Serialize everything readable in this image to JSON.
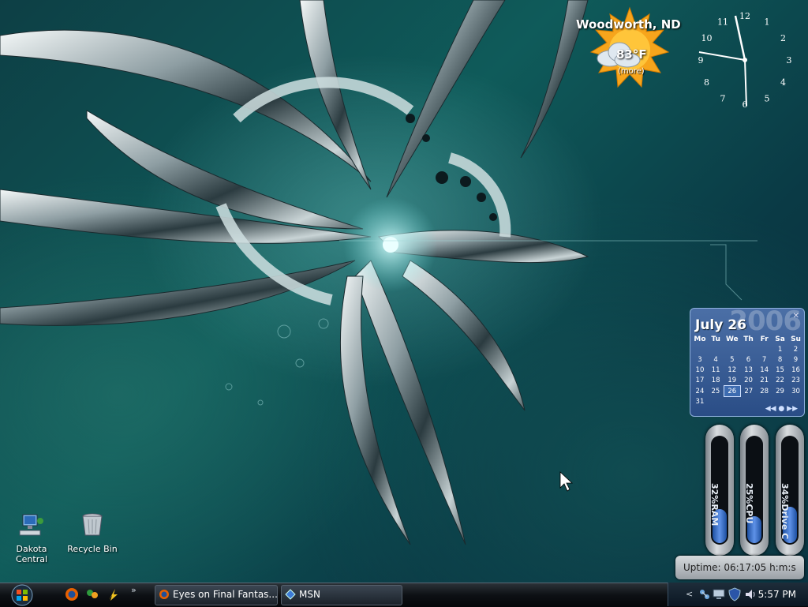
{
  "weather": {
    "city": "Woodworth,  ND",
    "temperature": "83°F",
    "more_link": "(more)"
  },
  "clock": {
    "numbers": [
      "12",
      "1",
      "2",
      "3",
      "4",
      "5",
      "6",
      "7",
      "8",
      "9",
      "10",
      "11"
    ]
  },
  "calendar": {
    "month_label": "July 26",
    "year_watermark": "2006",
    "weekdays": [
      "Mo",
      "Tu",
      "We",
      "Th",
      "Fr",
      "Sa",
      "Su"
    ],
    "weeks": [
      [
        "",
        "",
        "",
        "",
        "",
        "1",
        "2"
      ],
      [
        "3",
        "4",
        "5",
        "6",
        "7",
        "8",
        "9"
      ],
      [
        "10",
        "11",
        "12",
        "13",
        "14",
        "15",
        "16"
      ],
      [
        "17",
        "18",
        "19",
        "20",
        "21",
        "22",
        "23"
      ],
      [
        "24",
        "25",
        "26",
        "27",
        "28",
        "29",
        "30"
      ],
      [
        "31",
        "",
        "",
        "",
        "",
        "",
        ""
      ]
    ],
    "today": "26"
  },
  "gauges": [
    {
      "label": "32%RAM",
      "level": 0.32
    },
    {
      "label": "25%CPU",
      "level": 0.25
    },
    {
      "label": "34%Drive C",
      "level": 0.34
    }
  ],
  "uptime": "Uptime: 06:17:05 h:m:s",
  "desktop_icons": [
    {
      "label": "Dakota Central",
      "icon": "computer-network-icon"
    },
    {
      "label": "Recycle Bin",
      "icon": "recycle-bin-icon"
    }
  ],
  "taskbar": {
    "tasks": [
      {
        "label": "Eyes on Final Fantas...",
        "icon": "firefox-icon"
      },
      {
        "label": "MSN",
        "icon": "msn-icon"
      }
    ],
    "overflow": "»",
    "tray_chevron": "<",
    "time": "5:57 PM"
  }
}
